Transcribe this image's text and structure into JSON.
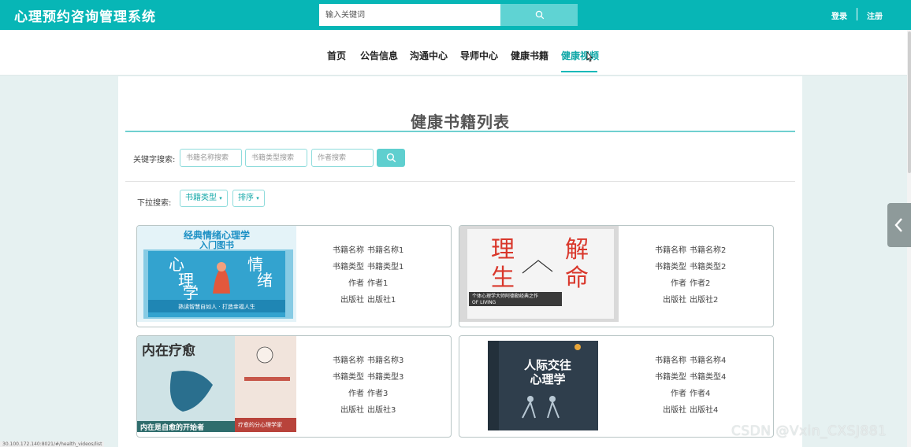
{
  "header": {
    "brand": "心理预约咨询管理系统",
    "search_placeholder": "输入关键词",
    "login": "登录",
    "register": "注册"
  },
  "nav": {
    "items": [
      "首页",
      "公告信息",
      "沟通中心",
      "导师中心",
      "健康书籍",
      "健康视频"
    ],
    "active_index": 5
  },
  "page": {
    "title": "健康书籍列表",
    "keyword_label": "关键字搜索:",
    "name_placeholder": "书籍名称搜索",
    "type_placeholder": "书籍类型搜索",
    "author_placeholder": "作者搜索",
    "dropdown_label": "下拉搜索:",
    "type_dropdown": "书籍类型",
    "sort_dropdown": "排序"
  },
  "field_labels": {
    "name": "书籍名称",
    "type": "书籍类型",
    "author": "作者",
    "publisher": "出版社"
  },
  "books": [
    {
      "name": "书籍名称1",
      "type": "书籍类型1",
      "author": "作者1",
      "publisher": "出版社1",
      "cover": {
        "title": "经典情绪心理学",
        "subtitle": "入门图书",
        "l1": "心",
        "l2": "情",
        "l3": "理",
        "l4": "绪",
        "l5": "学",
        "caption": "熟读智慧自如人 · 打造幸福人生"
      }
    },
    {
      "name": "书籍名称2",
      "type": "书籍类型2",
      "author": "作者2",
      "publisher": "出版社2",
      "cover": {
        "big1": "理",
        "big2": "解",
        "big3": "生",
        "big4": "命",
        "band": "个体心理学大师阿德勒经典之作",
        "band_en": "OF LIVING"
      }
    },
    {
      "name": "书籍名称3",
      "type": "书籍类型3",
      "author": "作者3",
      "publisher": "出版社3",
      "cover": {
        "title": "内在疗愈",
        "bottom": "内在是自愈的开始者",
        "tag": "疗愈的分心理学家"
      }
    },
    {
      "name": "书籍名称4",
      "type": "书籍类型4",
      "author": "作者4",
      "publisher": "出版社4",
      "cover": {
        "title1": "人际交往",
        "title2": "心理学"
      }
    }
  ],
  "watermark": "CSDN @Vxin_CXSJ881",
  "status_url": "30.100.172.140:8021/#/health_videos/list",
  "colors": {
    "primary": "#07b6b6",
    "accent": "#10a7a7",
    "border": "#8fdcdc"
  },
  "icons": {
    "search": "search-icon",
    "collapse": "chevron-left-icon"
  }
}
